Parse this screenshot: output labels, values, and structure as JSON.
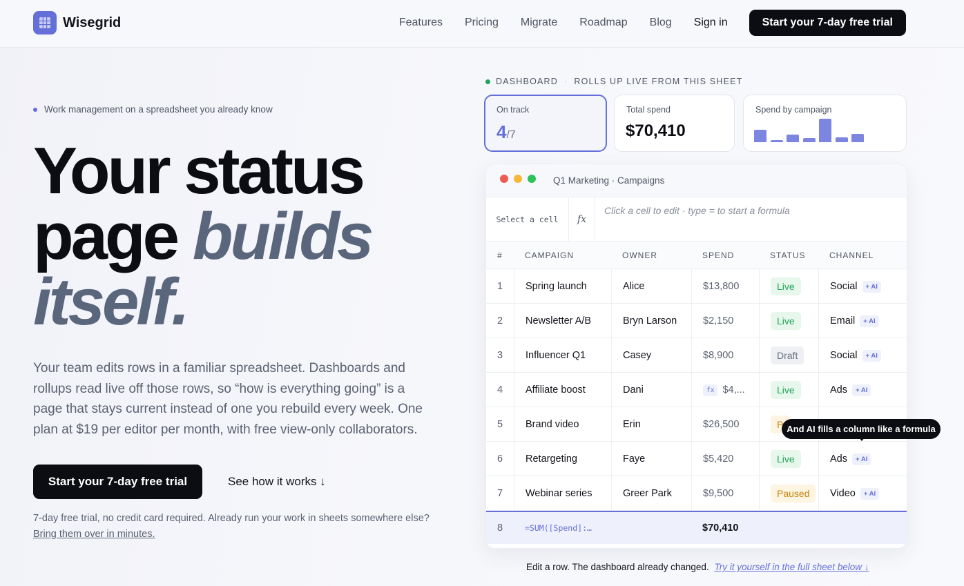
{
  "brand": {
    "name": "Wisegrid",
    "accent": "#6470d8"
  },
  "nav": {
    "links": [
      "Features",
      "Pricing",
      "Migrate",
      "Roadmap",
      "Blog"
    ],
    "signin": "Sign in",
    "cta": "Start your 7-day free trial"
  },
  "hero": {
    "eyebrow": "Work management on a spreadsheet you already know",
    "headline_plain_1": "Your status",
    "headline_plain_2": "page",
    "headline_accent_1": "builds",
    "headline_accent_2": "itself.",
    "lede": "Your team edits rows in a familiar spreadsheet. Dashboards and rollups read live off those rows, so “how is everything going” is a page that stays current instead of one you rebuild every week. One plan at $19 per editor per month, with free view-only collaborators.",
    "cta_primary": "Start your 7-day free trial",
    "cta_secondary": "See how it works ↓",
    "fineprint": "7-day free trial, no credit card required. Already run your work in sheets somewhere else?",
    "fineprint_link": "Bring them over in minutes."
  },
  "dashboard": {
    "label": "DASHBOARD",
    "sublabel": "ROLLS UP LIVE FROM THIS SHEET",
    "on_track_label": "On track",
    "on_track_value": "4",
    "on_track_total": "/7",
    "total_spend_label": "Total spend",
    "total_spend_value": "$70,410",
    "spend_by_campaign_label": "Spend by campaign",
    "spend_bars": [
      13800,
      2150,
      8900,
      4500,
      26500,
      5420,
      9500
    ]
  },
  "sheet": {
    "title": "Q1 Marketing · Campaigns",
    "cell_ref": "Select a cell",
    "fx": "fx",
    "formula_hint": "Click a cell to edit · type = to start a formula",
    "columns": [
      "#",
      "CAMPAIGN",
      "OWNER",
      "SPEND",
      "STATUS",
      "CHANNEL"
    ],
    "rows": [
      {
        "n": "1",
        "campaign": "Spring launch",
        "owner": "Alice",
        "spend": "$13,800",
        "status": "Live",
        "status_kind": "live",
        "channel": "Social",
        "ai": "+ AI"
      },
      {
        "n": "2",
        "campaign": "Newsletter A/B",
        "owner": "Bryn Larson",
        "spend": "$2,150",
        "status": "Live",
        "status_kind": "live",
        "channel": "Email",
        "ai": "+ AI"
      },
      {
        "n": "3",
        "campaign": "Influencer Q1",
        "owner": "Casey",
        "spend": "$8,900",
        "status": "Draft",
        "status_kind": "draft",
        "channel": "Social",
        "ai": "+ AI"
      },
      {
        "n": "4",
        "campaign": "Affiliate boost",
        "owner": "Dani",
        "spend": "$4,...",
        "spend_fx": "fx",
        "status": "Live",
        "status_kind": "live",
        "channel": "Ads",
        "ai": "+ AI"
      },
      {
        "n": "5",
        "campaign": "Brand video",
        "owner": "Erin",
        "spend": "$26,500",
        "status": "P",
        "status_kind": "pend",
        "channel": "",
        "ai": ""
      },
      {
        "n": "6",
        "campaign": "Retargeting",
        "owner": "Faye",
        "spend": "$5,420",
        "status": "Live",
        "status_kind": "live",
        "channel": "Ads",
        "ai": "+ AI"
      },
      {
        "n": "7",
        "campaign": "Webinar series",
        "owner": "Greer Park",
        "spend": "$9,500",
        "status": "Paused",
        "status_kind": "paused",
        "channel": "Video",
        "ai": "+ AI"
      }
    ],
    "sum_row": {
      "n": "8",
      "formula": "=SUM([Spend]:…",
      "total": "$70,410"
    }
  },
  "tooltip": "And AI fills a column like a formula",
  "caption": {
    "text": "Edit a row. The dashboard already changed.",
    "link": "Try it yourself in the full sheet below ↓"
  }
}
